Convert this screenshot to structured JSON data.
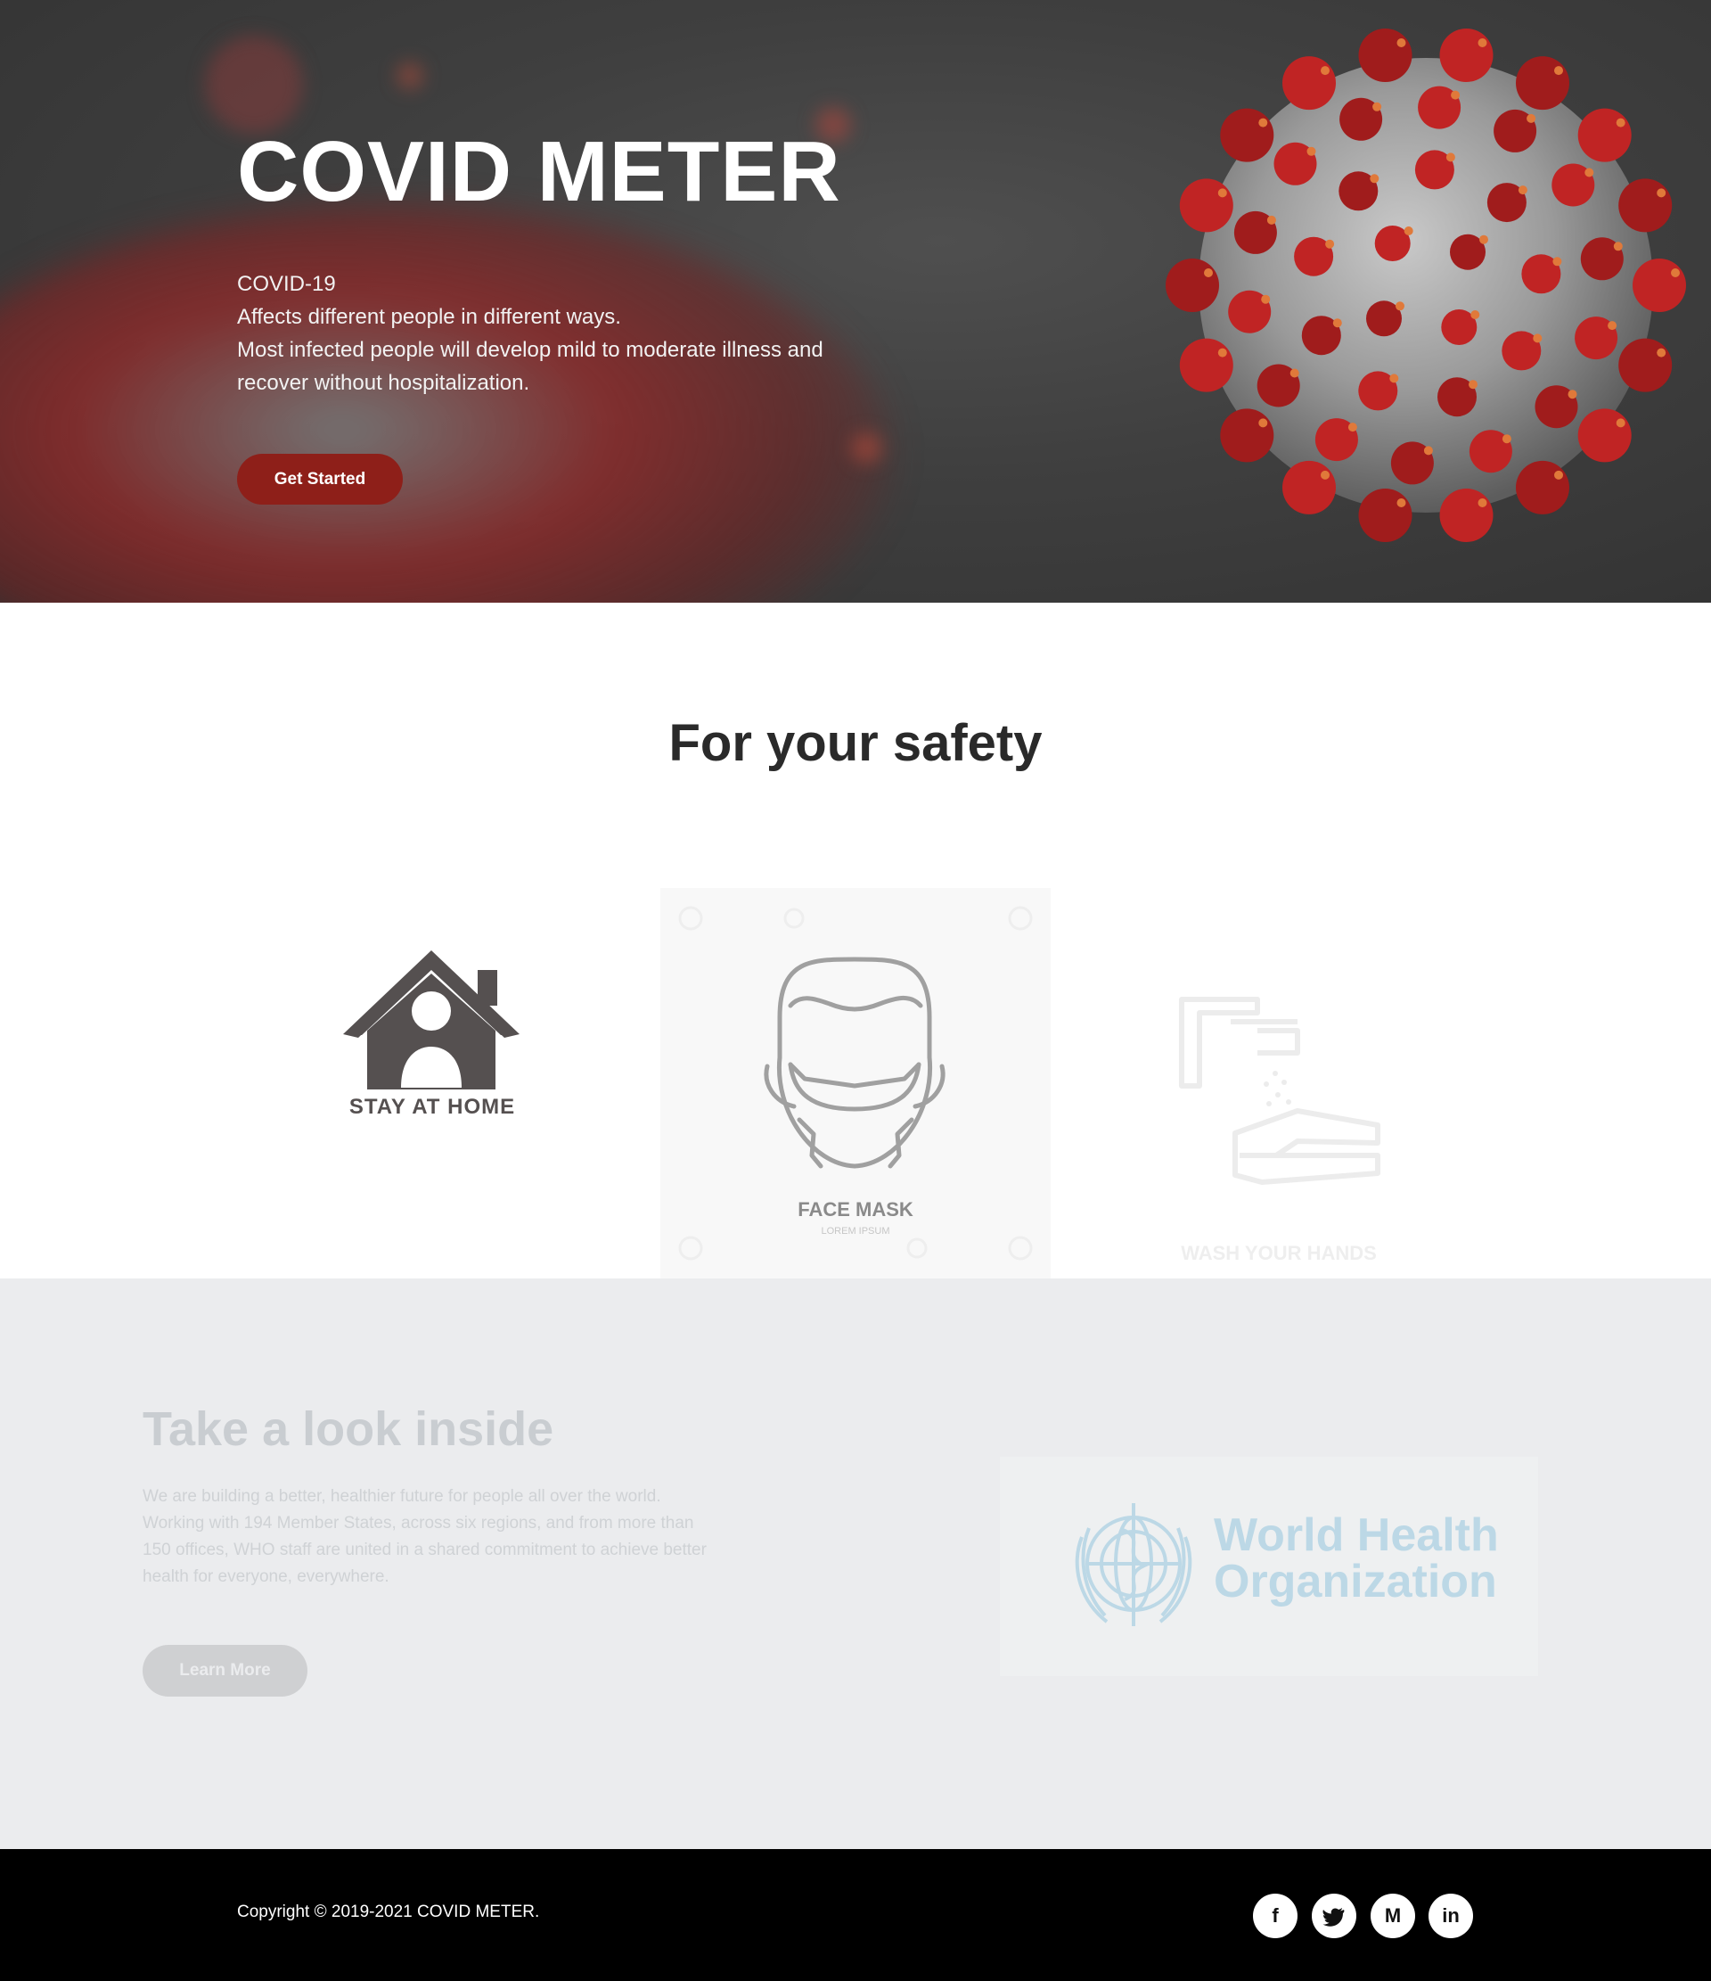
{
  "hero": {
    "title": "COVID METER",
    "lines": [
      "COVID-19",
      "Affects different people in different ways.",
      "Most infected people will develop mild to moderate illness and",
      "recover without hospitalization."
    ],
    "cta_label": "Get Started",
    "accent_color": "#8e1f19"
  },
  "safety": {
    "title": "For your safety",
    "cards": [
      {
        "label": "STAY AT HOME",
        "icon": "house-person-icon"
      },
      {
        "label": "FACE MASK",
        "sublabel": "LOREM IPSUM",
        "icon": "face-mask-icon"
      },
      {
        "label": "WASH YOUR HANDS",
        "icon": "hand-wash-icon"
      }
    ]
  },
  "inside": {
    "title": "Take a look inside",
    "lines": [
      "We are building a better, healthier future for people all over the world.",
      "Working with 194 Member States, across six regions, and from more than",
      "150 offices, WHO staff are united in a shared commitment to achieve better",
      "health for everyone, everywhere."
    ],
    "cta_label": "Learn More",
    "logo_text": [
      "World Health",
      "Organization"
    ]
  },
  "footer": {
    "copyright": "Copyright © 2019-2021 COVID METER.",
    "social": [
      {
        "name": "facebook-icon",
        "glyph": "f"
      },
      {
        "name": "twitter-icon",
        "glyph": "t"
      },
      {
        "name": "medium-icon",
        "glyph": "M"
      },
      {
        "name": "linkedin-icon",
        "glyph": "in"
      }
    ]
  }
}
